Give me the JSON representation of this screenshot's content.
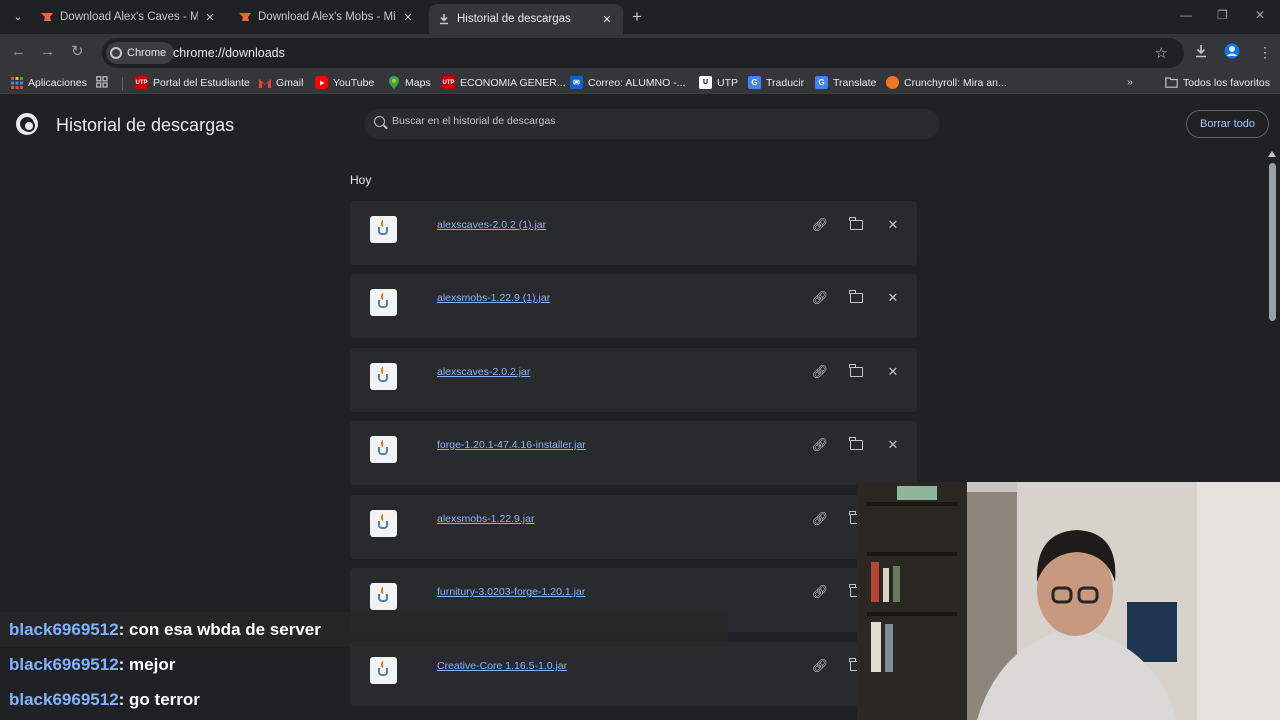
{
  "tabs": [
    {
      "title": "Download Alex's Caves - Minec",
      "active": false
    },
    {
      "title": "Download Alex's Mobs - Minec",
      "active": false
    },
    {
      "title": "Historial de descargas",
      "active": true
    }
  ],
  "toolbar": {
    "chip_label": "Chrome",
    "url": "chrome://downloads"
  },
  "bookmarks": [
    {
      "label": "Aplicaciones",
      "icon": "apps-grid-icon"
    },
    {
      "label": "Portal del Estudiante",
      "icon": "utp-icon"
    },
    {
      "label": "Gmail",
      "icon": "gmail-icon"
    },
    {
      "label": "YouTube",
      "icon": "youtube-icon"
    },
    {
      "label": "Maps",
      "icon": "maps-icon"
    },
    {
      "label": "ECONOMIA GENER...",
      "icon": "utp-icon"
    },
    {
      "label": "Correo: ALUMNO -...",
      "icon": "outlook-icon"
    },
    {
      "label": "UTP",
      "icon": "utp-icon"
    },
    {
      "label": "Traducir",
      "icon": "translate-icon"
    },
    {
      "label": "Translate",
      "icon": "translate-icon"
    },
    {
      "label": "Crunchyroll: Mira an...",
      "icon": "crunchyroll-icon"
    }
  ],
  "bookmarks_all": "Todos los favoritos",
  "page": {
    "title": "Historial de descargas",
    "search_placeholder": "Buscar en el historial de descargas",
    "clear_all": "Borrar todo",
    "section": "Hoy"
  },
  "downloads": [
    "alexscaves-2.0.2 (1).jar",
    "alexsmobs-1.22.9 (1).jar",
    "alexscaves-2.0.2.jar",
    "forge-1.20.1-47.4.16-installer.jar",
    "alexsmobs-1.22.9.jar",
    "furnitury-3.0203-forge-1.20.1.jar",
    "Creative-Core 1.16.5-1.0.jar"
  ],
  "chat": [
    {
      "user": "black6969512",
      "message": " : con esa wbda de server"
    },
    {
      "user": "black6969512",
      "message": " : mejor"
    },
    {
      "user": "black6969512",
      "message": " : go terror"
    }
  ],
  "colors": {
    "accent": "#8ab4f8",
    "background": "#202124",
    "card": "#292a2d",
    "chat_user": "#7fb2ff"
  }
}
